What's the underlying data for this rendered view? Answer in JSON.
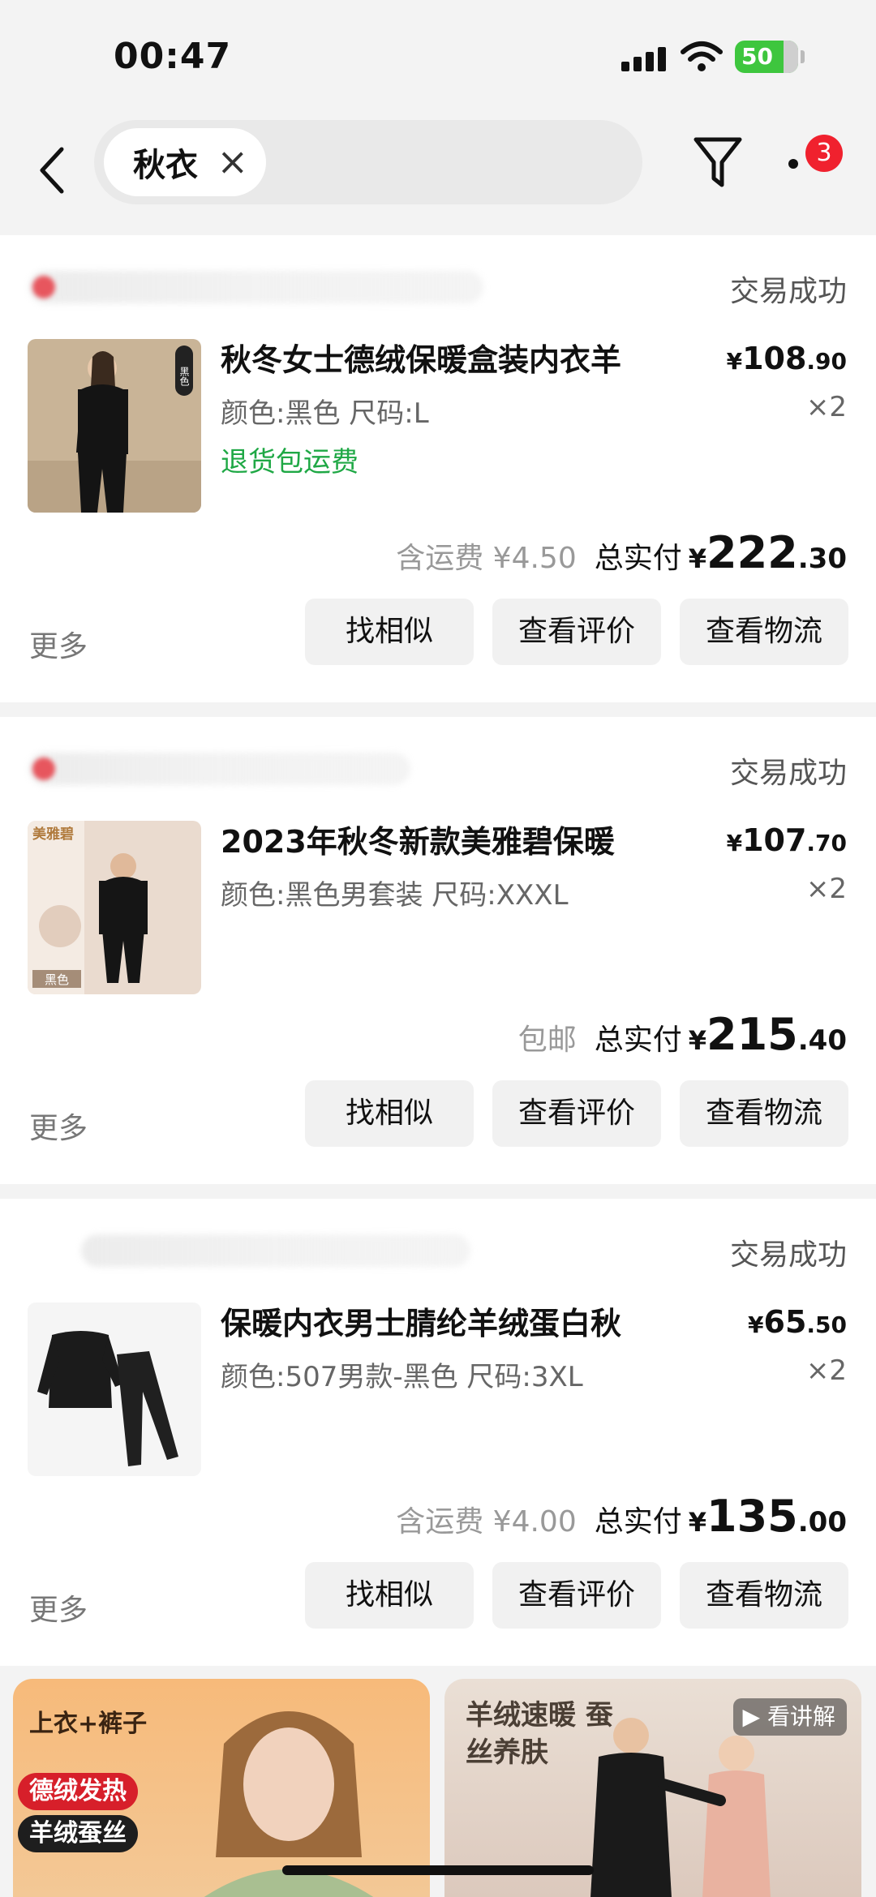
{
  "status_bar": {
    "time": "00:47",
    "battery": "50"
  },
  "search": {
    "chip_label": "秋衣",
    "chip_clear": "×",
    "filter_badge": "3"
  },
  "orders": [
    {
      "status": "交易成功",
      "title": "秋冬女士德绒保暖盒装内衣羊",
      "spec": "颜色:黑色 尺码:L",
      "refund_note": "退货包运费",
      "price_int": "108",
      "price_dec": ".90",
      "qty": "×2",
      "shipping": "含运费 ¥4.50",
      "total_label": "总实付",
      "total_int": "222",
      "total_dec": ".30"
    },
    {
      "status": "交易成功",
      "title": "2023年秋冬新款美雅碧保暖",
      "spec": "颜色:黑色男套装 尺码:XXXL",
      "refund_note": "",
      "price_int": "107",
      "price_dec": ".70",
      "qty": "×2",
      "shipping": "包邮",
      "total_label": "总实付",
      "total_int": "215",
      "total_dec": ".40"
    },
    {
      "status": "交易成功",
      "title": "保暖内衣男士腈纶羊绒蛋白秋",
      "spec": "颜色:507男款-黑色 尺码:3XL",
      "refund_note": "",
      "price_int": "65",
      "price_dec": ".50",
      "qty": "×2",
      "shipping": "含运费 ¥4.00",
      "total_label": "总实付",
      "total_int": "135",
      "total_dec": ".00"
    }
  ],
  "actions": {
    "more": "更多",
    "similar": "找相似",
    "reviews": "查看评价",
    "logistics": "查看物流",
    "currency": "¥"
  },
  "thumb_labels": {
    "order1_tag": "黑色",
    "order2_brand": "美雅碧",
    "order2_color": "黑色"
  },
  "recommendations": [
    {
      "headline": "上衣+裤子",
      "tags": [
        "德绒发热",
        "羊绒蚕丝"
      ]
    },
    {
      "headline": "羊绒速暖 蚕丝养肤",
      "play_label": "看讲解"
    }
  ]
}
